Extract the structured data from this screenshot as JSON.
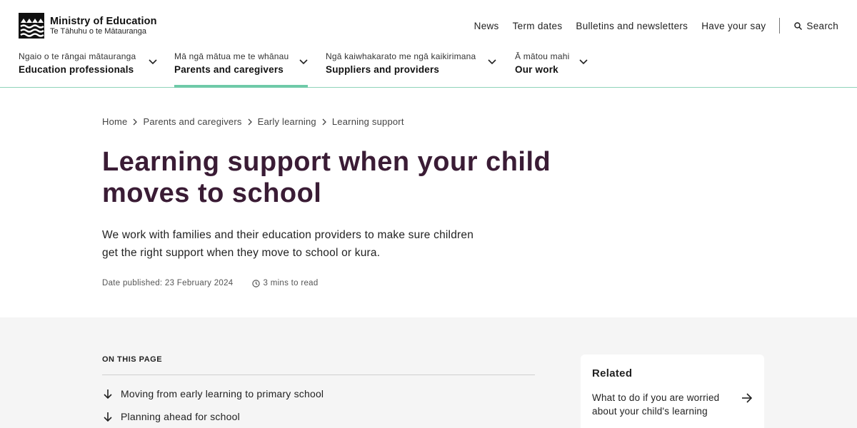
{
  "site": {
    "name": "Ministry of Education",
    "maori_name": "Te Tāhuhu o te Mātauranga"
  },
  "utility_nav": [
    {
      "label": "News"
    },
    {
      "label": "Term dates"
    },
    {
      "label": "Bulletins and newsletters"
    },
    {
      "label": "Have your say"
    }
  ],
  "search": {
    "label": "Search"
  },
  "main_nav": [
    {
      "maori": "Ngaio o te rāngai mātauranga",
      "label": "Education professionals",
      "active": false
    },
    {
      "maori": "Mā ngā mātua me te whānau",
      "label": "Parents and caregivers",
      "active": true
    },
    {
      "maori": "Ngā kaiwhakarato me ngā kaikirimana",
      "label": "Suppliers and providers",
      "active": false
    },
    {
      "maori": "Ā mātou mahi",
      "label": "Our work",
      "active": false
    }
  ],
  "breadcrumb": [
    "Home",
    "Parents and caregivers",
    "Early learning",
    "Learning support"
  ],
  "page": {
    "title": "Learning support when your child moves to school",
    "intro": "We work with families and their education providers to make sure children get the right support when they move to school or kura.",
    "date_published": "Date published: 23 February 2024",
    "read_time": "3 mins to read"
  },
  "on_this_page": {
    "heading": "ON THIS PAGE",
    "items": [
      "Moving from early learning to primary school",
      "Planning ahead for school"
    ]
  },
  "related": {
    "title": "Related",
    "links": [
      "What to do if you are worried about your child's learning"
    ]
  },
  "colors": {
    "title": "#3a1c35",
    "accent": "#6fcaa8",
    "section_bg": "#f5f5f5"
  }
}
